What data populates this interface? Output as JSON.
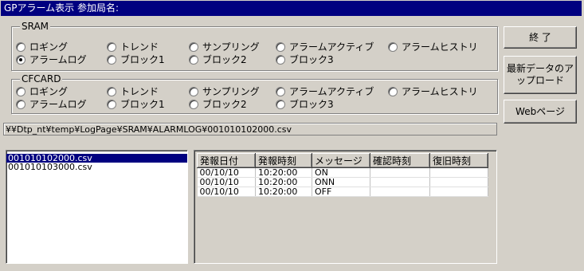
{
  "window": {
    "title": "GPアラーム表示  参加局名:"
  },
  "sram": {
    "label": "SRAM",
    "options": [
      "ロギング",
      "トレンド",
      "サンプリング",
      "アラームアクティブ",
      "アラームヒストリ",
      "アラームログ",
      "ブロック1",
      "ブロック2",
      "ブロック3"
    ],
    "selected": "アラームログ"
  },
  "cfcard": {
    "label": "CFCARD",
    "options": [
      "ロギング",
      "トレンド",
      "サンプリング",
      "アラームアクティブ",
      "アラームヒストリ",
      "アラームログ",
      "ブロック1",
      "ブロック2",
      "ブロック3"
    ]
  },
  "buttons": {
    "exit": "終 了",
    "upload_line1": "最新データのア",
    "upload_line2": "ップロード",
    "web": "Webページ"
  },
  "path": "¥¥Dtp_nt¥temp¥LogPage¥SRAM¥ALARMLOG¥001010102000.csv",
  "files": [
    "001010102000.csv",
    "001010103000.csv"
  ],
  "selected_file": "001010102000.csv",
  "table": {
    "headers": [
      "発報日付",
      "発報時刻",
      "メッセージ",
      "確認時刻",
      "復旧時刻"
    ],
    "rows": [
      [
        "00/10/10",
        "10:20:00",
        "ON",
        "",
        ""
      ],
      [
        "00/10/10",
        "10:20:00",
        "ONN",
        "",
        ""
      ],
      [
        "00/10/10",
        "10:20:00",
        "OFF",
        "",
        ""
      ]
    ]
  }
}
